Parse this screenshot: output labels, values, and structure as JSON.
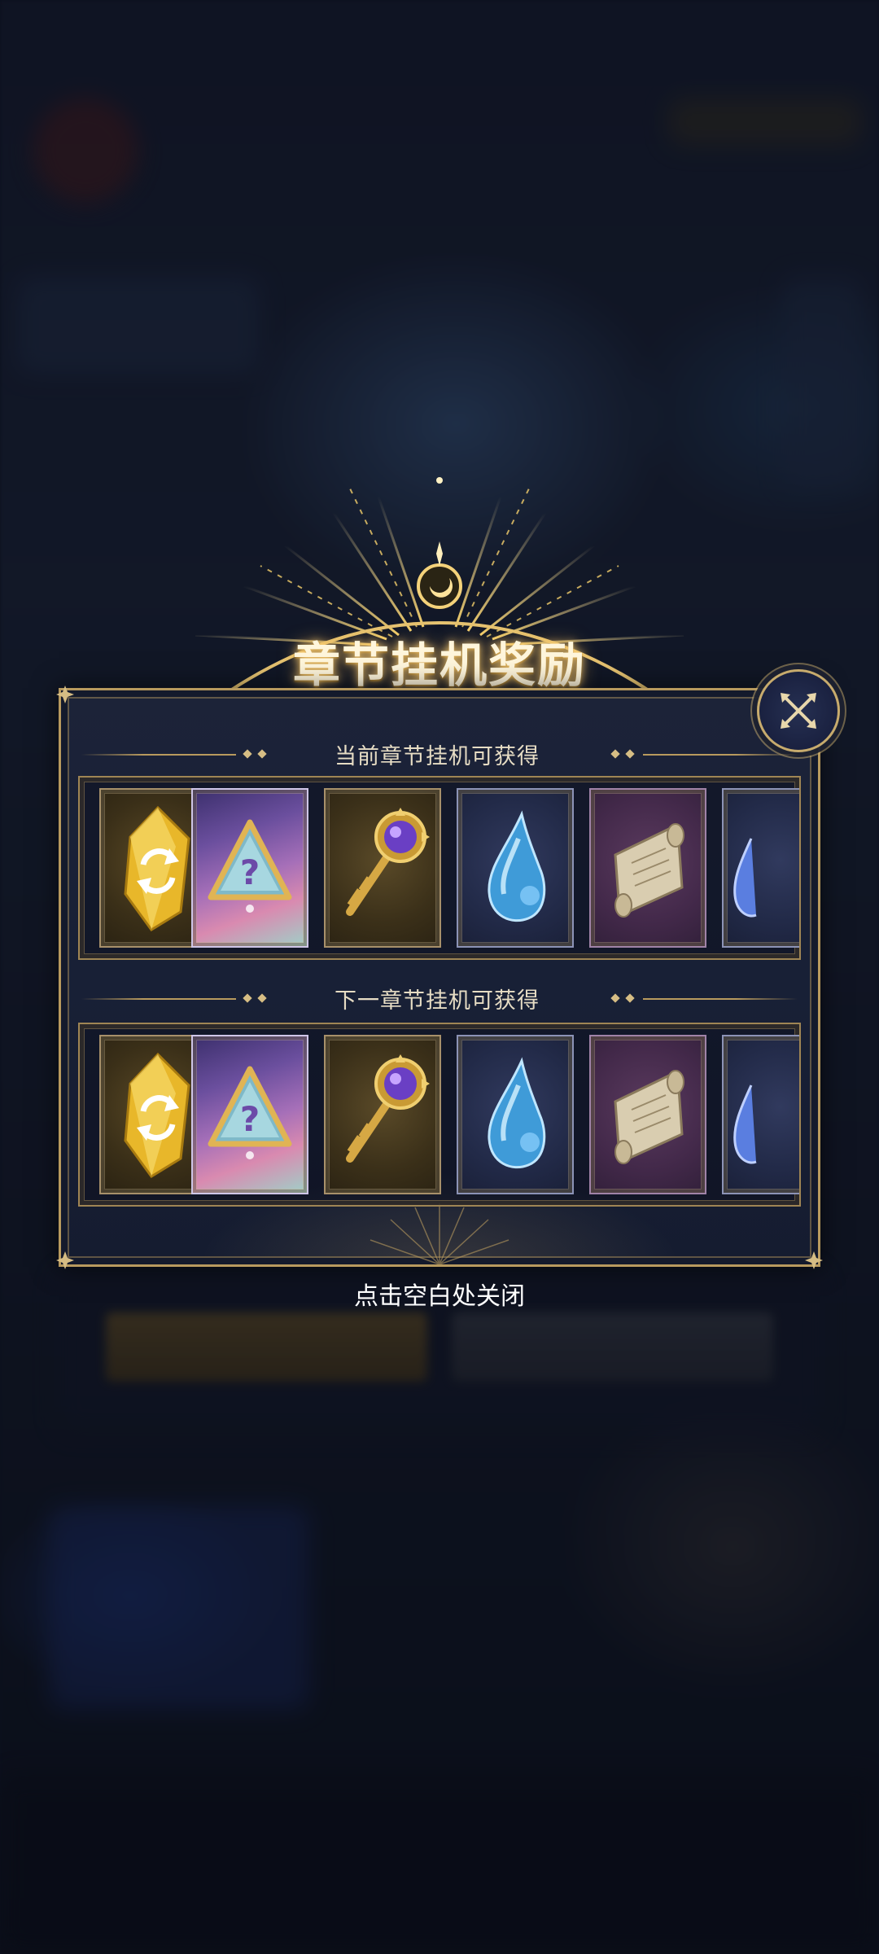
{
  "popup": {
    "title": "章节挂机奖励",
    "current_section": {
      "label": "当前章节挂机可获得",
      "items": [
        {
          "icon": "gold-refresh-crystal-icon"
        },
        {
          "icon": "mystery-triangle-card-icon"
        },
        {
          "icon": "gold-gem-key-icon"
        },
        {
          "icon": "blue-water-drop-gem-icon"
        },
        {
          "icon": "parchment-scroll-icon"
        },
        {
          "icon": "blue-gem-partial-icon"
        }
      ]
    },
    "next_section": {
      "label": "下一章节挂机可获得",
      "items": [
        {
          "icon": "gold-refresh-crystal-icon"
        },
        {
          "icon": "mystery-triangle-card-icon"
        },
        {
          "icon": "gold-gem-key-icon"
        },
        {
          "icon": "blue-water-drop-gem-icon"
        },
        {
          "icon": "parchment-scroll-icon"
        },
        {
          "icon": "blue-gem-partial-icon"
        }
      ]
    },
    "close_hint": "点击空白处关闭"
  },
  "colors": {
    "gold_border": "#b89a5e",
    "panel_bg": "#1c2338",
    "title_glow": "#ffd27a"
  }
}
